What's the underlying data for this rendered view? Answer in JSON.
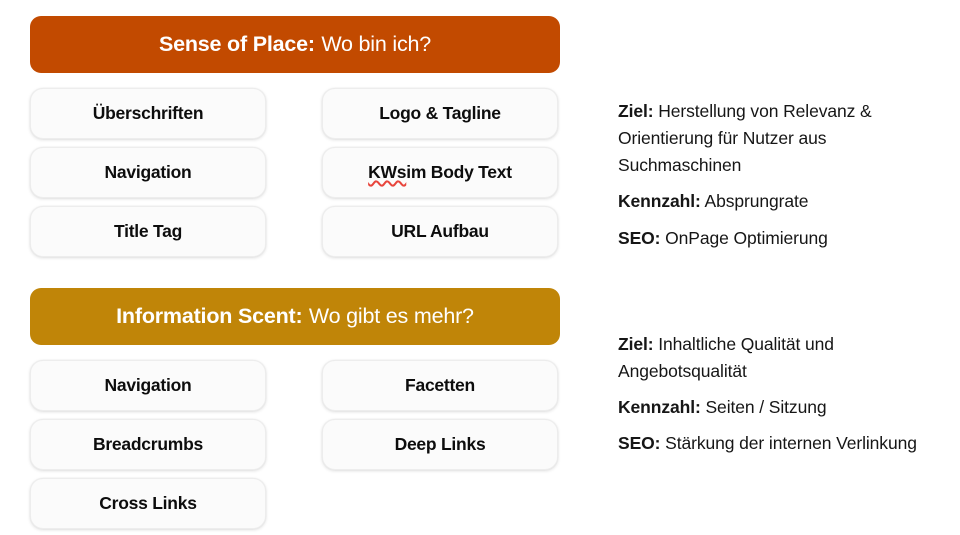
{
  "theme": {
    "background": "#ffffff",
    "band_sense_of_place": "#C24A00",
    "band_information_scent": "#C08508",
    "pill_background": "#fbfbfb",
    "text_color": "#0d0d0d",
    "spellcheck_underline": "#e8453c"
  },
  "sections": [
    {
      "band": {
        "term": "Sense of Place:",
        "question": "Wo bin ich?",
        "color": "#C24A00"
      },
      "pills_left": [
        {
          "label": "Überschriften"
        },
        {
          "label": "Navigation"
        },
        {
          "label": "Title Tag"
        }
      ],
      "pills_right": [
        {
          "label": "Logo & Tagline"
        },
        {
          "label": "KWs im Body Text",
          "misspelled_word": "KWs",
          "rest": " im Body Text"
        },
        {
          "label": "URL Aufbau"
        }
      ],
      "info": [
        {
          "label": "Ziel:",
          "value": "Herstellung von Relevanz & Orientierung für Nutzer aus Suchmaschinen"
        },
        {
          "label": "Kennzahl:",
          "value": "Absprungrate"
        },
        {
          "label": "SEO:",
          "value": "OnPage Optimierung"
        }
      ]
    },
    {
      "band": {
        "term": "Information Scent:",
        "question": "Wo gibt es mehr?",
        "color": "#C08508"
      },
      "pills_left": [
        {
          "label": "Navigation"
        },
        {
          "label": "Breadcrumbs"
        },
        {
          "label": "Cross Links"
        }
      ],
      "pills_right": [
        {
          "label": "Facetten"
        },
        {
          "label": "Deep Links"
        }
      ],
      "info": [
        {
          "label": "Ziel:",
          "value": "Inhaltliche Qualität und Angebotsqualität"
        },
        {
          "label": "Kennzahl:",
          "value": "Seiten / Sitzung"
        },
        {
          "label": "SEO:",
          "value": "Stärkung der internen Verlinkung"
        }
      ]
    }
  ]
}
